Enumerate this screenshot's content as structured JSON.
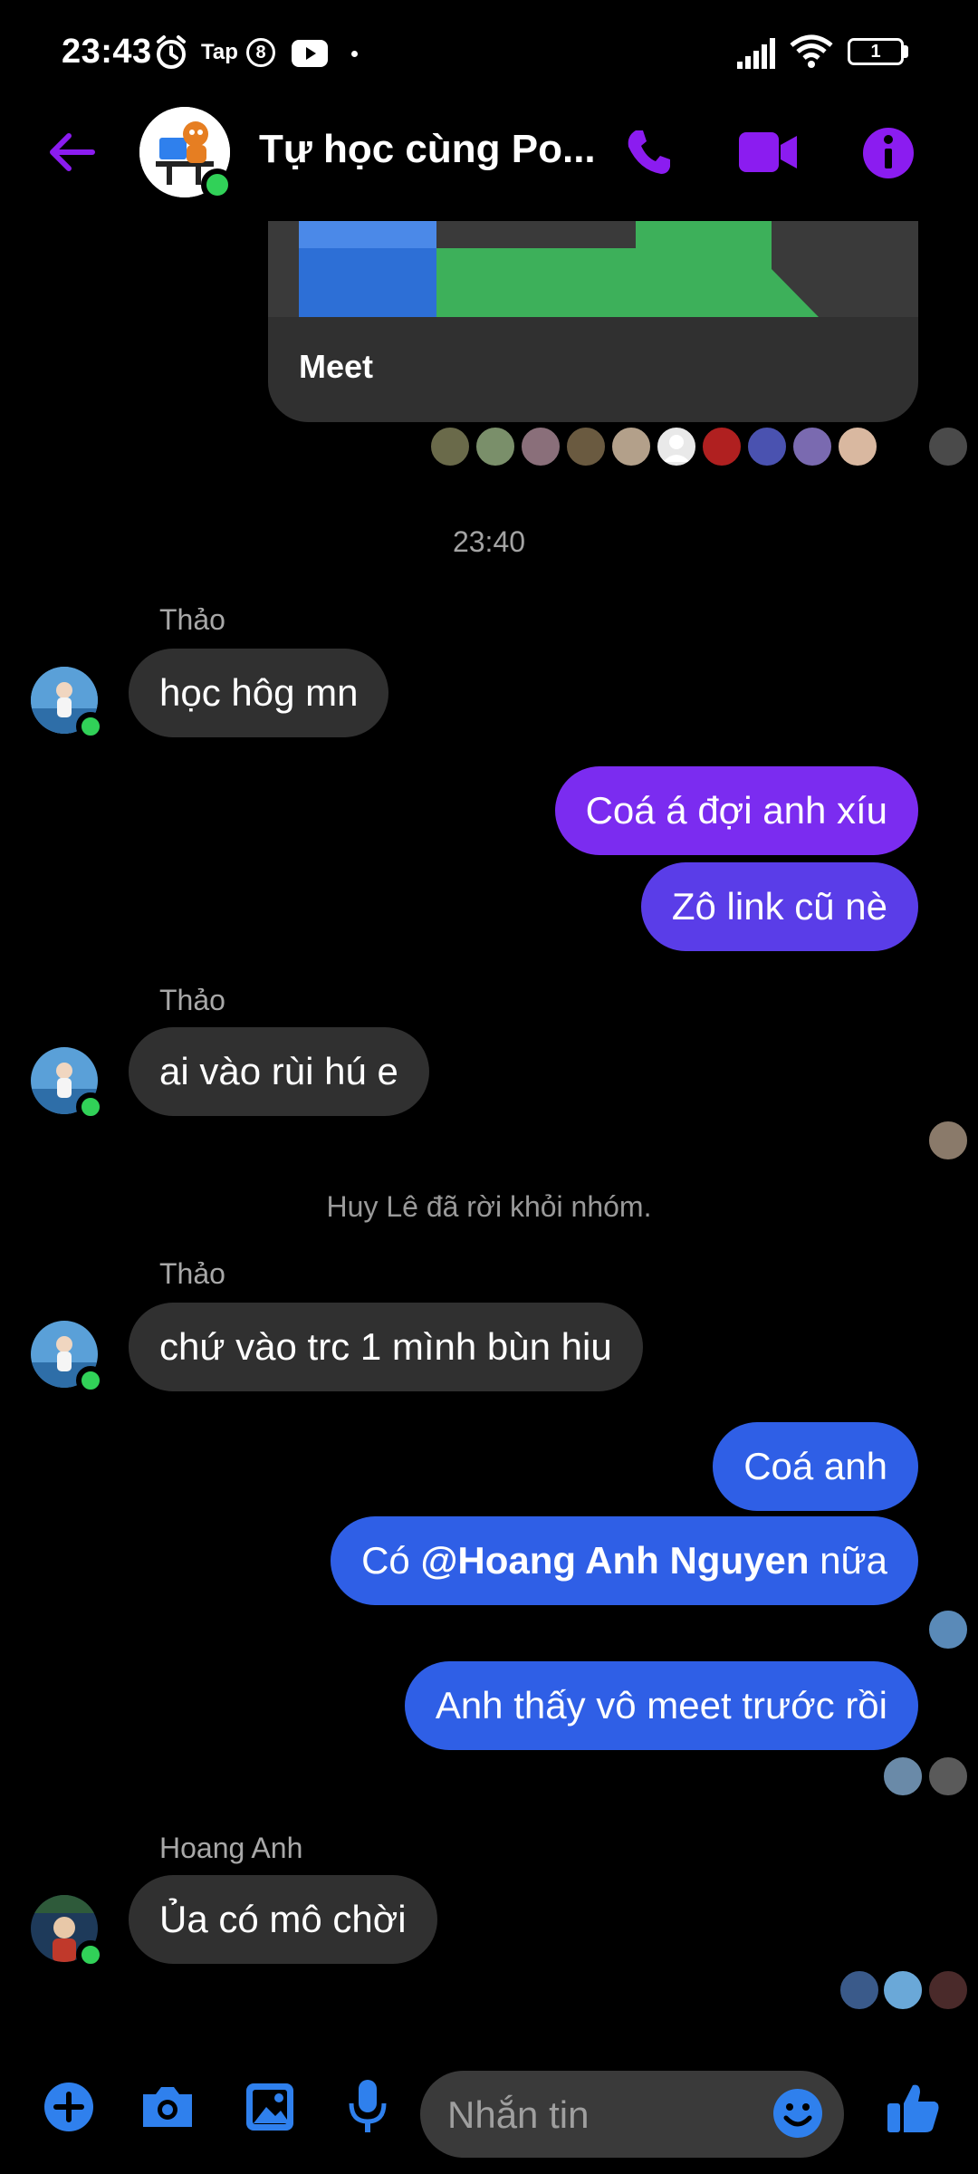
{
  "status_bar": {
    "time": "23:43",
    "notification_icons": [
      "alarm-icon",
      "tap-app-icon",
      "badge-8-icon",
      "youtube-icon",
      "dot-icon"
    ],
    "tap_label": "Tap",
    "badge_number": "8",
    "signal_icon": "signal-icon",
    "wifi_icon": "wifi-icon",
    "battery_level": "1"
  },
  "header": {
    "title": "Tự học cùng Po...",
    "back_icon": "back-arrow-icon",
    "call_icon": "phone-icon",
    "video_icon": "video-icon",
    "info_icon": "info-icon",
    "accent_color": "#8b1cf0"
  },
  "messages": {
    "meet_card_label": "Meet",
    "time_separator": "23:40",
    "group1_sender": "Thảo",
    "group1_msg": "học hôg mn",
    "out1_msg1": "Coá á đợi anh xíu",
    "out1_msg2": "Zô link cũ nè",
    "group2_sender": "Thảo",
    "group2_msg": "ai vào rùi hú e",
    "system_msg": "Huy Lê đã rời khỏi nhóm.",
    "group3_sender": "Thảo",
    "group3_msg": "chứ vào trc 1 mình bùn hiu",
    "out2_msg1": "Coá anh",
    "out2_msg2_prefix": "Có ",
    "out2_msg2_mention": "@Hoang Anh Nguyen",
    "out2_msg2_suffix": " nữa",
    "out3_msg1": "Anh thấy vô meet trước rồi",
    "group4_sender": "Hoang Anh",
    "group4_msg": "Ủa có mô chời"
  },
  "composer": {
    "placeholder": "Nhắn tin",
    "plus_icon": "plus-icon",
    "camera_icon": "camera-icon",
    "gallery_icon": "image-icon",
    "mic_icon": "mic-icon",
    "emoji_icon": "emoji-icon",
    "like_icon": "thumbs-up-icon",
    "accent_color": "#2f80ed"
  }
}
